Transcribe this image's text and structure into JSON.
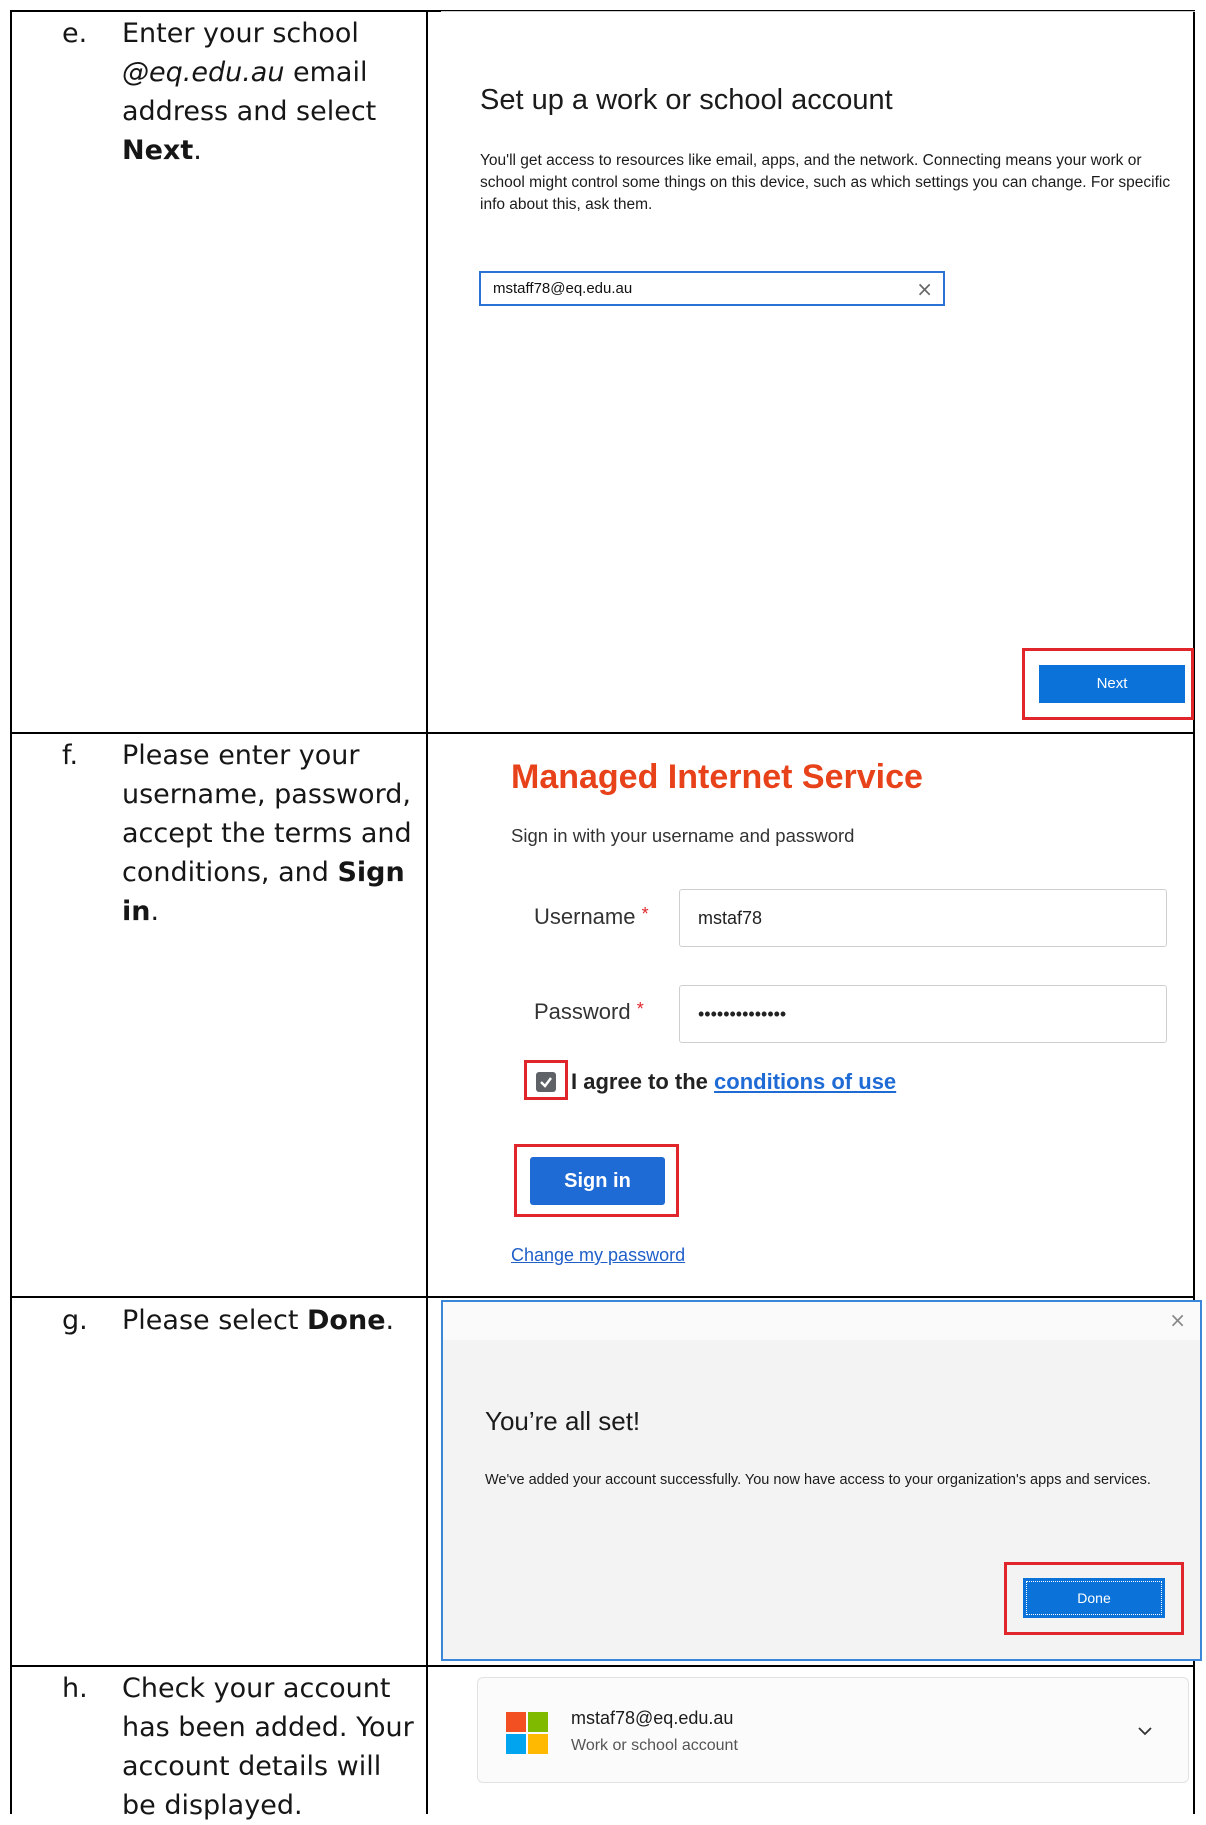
{
  "steps": {
    "e": {
      "letter": "e.",
      "pre": "Enter your school ",
      "italic": "@eq.edu.au",
      "mid": " email address and select ",
      "bold": "Next",
      "post": "."
    },
    "f": {
      "letter": "f.",
      "pre": "Please enter your username, password, accept the terms and conditions, and ",
      "bold": "Sign in",
      "post": "."
    },
    "g": {
      "letter": "g.",
      "pre": "Please select ",
      "bold": "Done",
      "post": "."
    },
    "h": {
      "letter": "h.",
      "text": "Check your account has been added. Your account details will be displayed."
    }
  },
  "panel_e": {
    "title": "Set up a work or school account",
    "description": "You'll get access to resources like email, apps, and the network. Connecting means your work or school might control some things on this device, such as which settings you can change. For specific info about this, ask them.",
    "email_value": "mstaff78@eq.edu.au",
    "clear_glyph": "×",
    "next_label": "Next",
    "highlight_color": "#e0262b",
    "button_color": "#0a72d8"
  },
  "panel_f": {
    "title": "Managed Internet Service",
    "subtitle": "Sign in with your username and password",
    "username_label": "Username",
    "password_label": "Password",
    "required_mark": "*",
    "username_value": "mstaf78",
    "password_value": "••••••••••••••",
    "checkbox_checked": true,
    "agree_text": "I agree to the ",
    "conditions_link": "conditions of use",
    "signin_label": "Sign in",
    "change_password_link": "Change my password",
    "title_color": "#e8421a"
  },
  "panel_g": {
    "close_glyph": "×",
    "title": "You’re all set!",
    "description": "We've added your account successfully. You now have access to your organization's apps and services.",
    "done_label": "Done"
  },
  "panel_h": {
    "email": "mstaf78@eq.edu.au",
    "account_type": "Work or school account",
    "logo_colors": [
      "#f25022",
      "#7fba00",
      "#00a4ef",
      "#ffb900"
    ]
  }
}
